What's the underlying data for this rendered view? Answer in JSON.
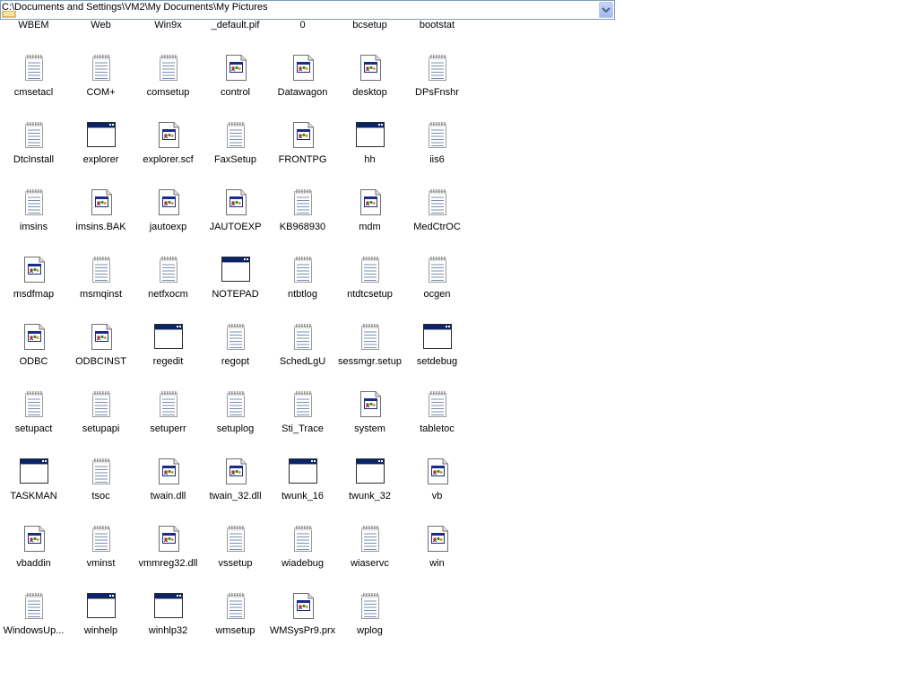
{
  "address_bar": {
    "path": "C:\\Documents and Settings\\VM2\\My Documents\\My Pictures"
  },
  "files": [
    {
      "label": "WBEM",
      "icon": "folder-partial"
    },
    {
      "label": "Web",
      "icon": "folder-partial"
    },
    {
      "label": "Win9x",
      "icon": "folder-partial"
    },
    {
      "label": "_default.pif",
      "icon": "folder-partial"
    },
    {
      "label": "0",
      "icon": "folder-partial"
    },
    {
      "label": "bcsetup",
      "icon": "folder-partial"
    },
    {
      "label": "bootstat",
      "icon": "folder-partial"
    },
    {
      "label": "cmsetacl",
      "icon": "notepad-icon"
    },
    {
      "label": "COM+",
      "icon": "notepad-icon"
    },
    {
      "label": "comsetup",
      "icon": "notepad-icon"
    },
    {
      "label": "control",
      "icon": "config-file-icon"
    },
    {
      "label": "Datawagon",
      "icon": "config-file-icon"
    },
    {
      "label": "desktop",
      "icon": "config-file-icon"
    },
    {
      "label": "DPsFnshr",
      "icon": "notepad-icon"
    },
    {
      "label": "DtcInstall",
      "icon": "notepad-icon"
    },
    {
      "label": "explorer",
      "icon": "window-app-icon"
    },
    {
      "label": "explorer.scf",
      "icon": "config-file-icon"
    },
    {
      "label": "FaxSetup",
      "icon": "notepad-icon"
    },
    {
      "label": "FRONTPG",
      "icon": "config-file-icon"
    },
    {
      "label": "hh",
      "icon": "window-app-icon"
    },
    {
      "label": "iis6",
      "icon": "notepad-icon"
    },
    {
      "label": "imsins",
      "icon": "notepad-icon"
    },
    {
      "label": "imsins.BAK",
      "icon": "config-file-icon"
    },
    {
      "label": "jautoexp",
      "icon": "config-file-icon"
    },
    {
      "label": "JAUTOEXP",
      "icon": "config-file-icon"
    },
    {
      "label": "KB968930",
      "icon": "notepad-icon"
    },
    {
      "label": "mdm",
      "icon": "config-file-icon"
    },
    {
      "label": "MedCtrOC",
      "icon": "notepad-icon"
    },
    {
      "label": "msdfmap",
      "icon": "config-file-icon"
    },
    {
      "label": "msmqinst",
      "icon": "notepad-icon"
    },
    {
      "label": "netfxocm",
      "icon": "notepad-icon"
    },
    {
      "label": "NOTEPAD",
      "icon": "window-app-icon"
    },
    {
      "label": "ntbtlog",
      "icon": "notepad-icon"
    },
    {
      "label": "ntdtcsetup",
      "icon": "notepad-icon"
    },
    {
      "label": "ocgen",
      "icon": "notepad-icon"
    },
    {
      "label": "ODBC",
      "icon": "config-file-icon"
    },
    {
      "label": "ODBCINST",
      "icon": "config-file-icon"
    },
    {
      "label": "regedit",
      "icon": "window-app-icon"
    },
    {
      "label": "regopt",
      "icon": "notepad-icon"
    },
    {
      "label": "SchedLgU",
      "icon": "notepad-icon"
    },
    {
      "label": "sessmgr.setup",
      "icon": "notepad-icon"
    },
    {
      "label": "setdebug",
      "icon": "window-app-icon"
    },
    {
      "label": "setupact",
      "icon": "notepad-icon"
    },
    {
      "label": "setupapi",
      "icon": "notepad-icon"
    },
    {
      "label": "setuperr",
      "icon": "notepad-icon"
    },
    {
      "label": "setuplog",
      "icon": "notepad-icon"
    },
    {
      "label": "Sti_Trace",
      "icon": "notepad-icon"
    },
    {
      "label": "system",
      "icon": "config-file-icon"
    },
    {
      "label": "tabletoc",
      "icon": "notepad-icon"
    },
    {
      "label": "TASKMAN",
      "icon": "window-app-icon"
    },
    {
      "label": "tsoc",
      "icon": "notepad-icon"
    },
    {
      "label": "twain.dll",
      "icon": "config-file-icon"
    },
    {
      "label": "twain_32.dll",
      "icon": "config-file-icon"
    },
    {
      "label": "twunk_16",
      "icon": "window-app-icon"
    },
    {
      "label": "twunk_32",
      "icon": "window-app-icon"
    },
    {
      "label": "vb",
      "icon": "config-file-icon"
    },
    {
      "label": "vbaddin",
      "icon": "config-file-icon"
    },
    {
      "label": "vminst",
      "icon": "notepad-icon"
    },
    {
      "label": "vmmreg32.dll",
      "icon": "config-file-icon"
    },
    {
      "label": "vssetup",
      "icon": "notepad-icon"
    },
    {
      "label": "wiadebug",
      "icon": "notepad-icon"
    },
    {
      "label": "wiaservc",
      "icon": "notepad-icon"
    },
    {
      "label": "win",
      "icon": "config-file-icon"
    },
    {
      "label": "WindowsUp...",
      "icon": "notepad-icon"
    },
    {
      "label": "winhelp",
      "icon": "window-app-icon"
    },
    {
      "label": "winhlp32",
      "icon": "window-app-icon"
    },
    {
      "label": "wmsetup",
      "icon": "notepad-icon"
    },
    {
      "label": "WMSysPr9.prx",
      "icon": "config-file-icon"
    },
    {
      "label": "wplog",
      "icon": "notepad-icon"
    }
  ],
  "colors": {
    "title_blue": "#0a246a",
    "border_gray": "#7f9db9"
  }
}
